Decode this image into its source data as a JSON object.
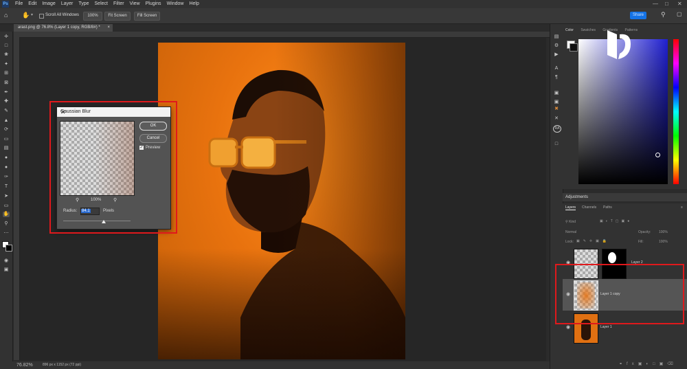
{
  "app": {
    "logo": "Ps",
    "menu": [
      "File",
      "Edit",
      "Image",
      "Layer",
      "Type",
      "Select",
      "Filter",
      "View",
      "Plugins",
      "Window",
      "Help"
    ]
  },
  "options_bar": {
    "scroll_all_windows": "Scroll All Windows",
    "zoom_100": "100%",
    "fit_screen": "Fit Screen",
    "fill_screen": "Fill Screen",
    "share": "Share"
  },
  "document": {
    "tab_title": "arast.png @ 76.8% (Layer 1 copy, RGB/8#) *"
  },
  "status": {
    "zoom": "76.82%",
    "doc_info": "896 px x 1152 px (72 ppi)"
  },
  "color_panel": {
    "tabs": [
      "Color",
      "Swatches",
      "Gradients",
      "Patterns"
    ]
  },
  "adjustments": {
    "title": "Adjustments"
  },
  "layers_panel": {
    "tabs": [
      "Layers",
      "Channels",
      "Paths"
    ],
    "filter_label": "Kind",
    "blend_mode": "Normal",
    "opacity_label": "Opacity:",
    "opacity_value": "100%",
    "lock_label": "Lock:",
    "fill_label": "Fill:",
    "fill_value": "100%",
    "layers": [
      {
        "name": "Layer 2",
        "visible": true
      },
      {
        "name": "Layer 1 copy",
        "visible": true,
        "selected": true
      },
      {
        "name": "Layer 1",
        "visible": true
      }
    ]
  },
  "dialog": {
    "title": "Gaussian Blur",
    "ok": "OK",
    "cancel": "Cancel",
    "preview_label": "Preview",
    "preview_checked": true,
    "zoom": "100%",
    "radius_label": "Radius:",
    "radius_value": "84.1",
    "units": "Pixels",
    "slider_fraction": 0.6
  },
  "colors": {
    "highlight": "#e0191c",
    "accent": "#1473e6"
  }
}
